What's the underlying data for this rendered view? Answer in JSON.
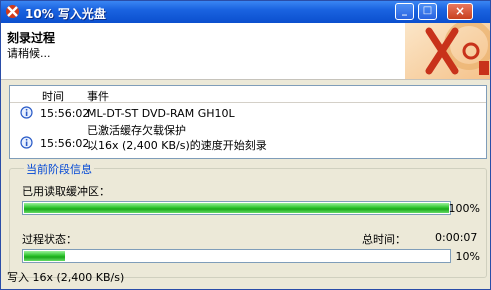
{
  "window": {
    "title": "10% 写入光盘",
    "minimize_glyph": "_",
    "maximize_glyph": "□",
    "close_glyph": "×"
  },
  "header": {
    "title": "刻录过程",
    "subtitle": "请稍候..."
  },
  "log": {
    "columns": {
      "time": "时间",
      "event": "事件"
    },
    "rows": [
      {
        "time": "15:56:02",
        "event": "ML-DT-ST DVD-RAM GH10L",
        "icon": "info-icon"
      },
      {
        "time": "",
        "event": "已激活缓存欠载保护",
        "icon": ""
      },
      {
        "time": "15:56:02",
        "event": "以16x (2,400 KB/s)的速度开始刻录",
        "icon": "info-icon"
      }
    ]
  },
  "stage": {
    "group_title": "当前阶段信息",
    "buffer_label": "已用读取缓冲区：",
    "buffer_percent_text": "100%",
    "buffer_fraction": 1.0,
    "process_label": "过程状态：",
    "total_time_label": "总时间：",
    "total_time_value": "0:00:07",
    "process_percent_text": "10%",
    "process_fraction": 0.1
  },
  "status": {
    "text": "写入 16x (2,400 KB/s)"
  },
  "colors": {
    "titlebar": "#0b4fce",
    "progress_green": "#2fc52f",
    "group_title": "#0046d5"
  }
}
